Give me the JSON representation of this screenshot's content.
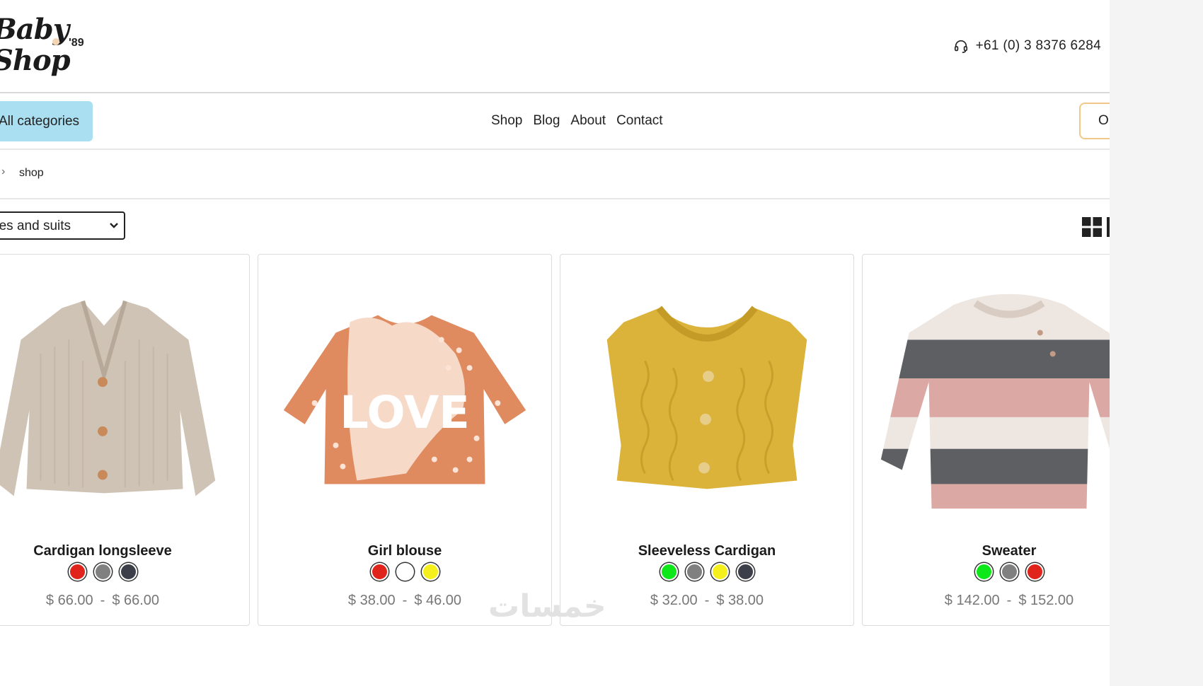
{
  "header": {
    "logo_line1": "Baby",
    "logo_line2": "Shop",
    "logo_year": "'89",
    "phone": "+61 (0) 3 8376 6284"
  },
  "nav": {
    "all_categories": "All categories",
    "menu": [
      "Shop",
      "Blog",
      "About",
      "Contact"
    ],
    "cart_label": "O"
  },
  "breadcrumb": {
    "separator": "›",
    "current": "shop"
  },
  "filter": {
    "selected_category": "Dresses and suits"
  },
  "products": [
    {
      "name": "Cardigan longsleeve",
      "colors": [
        "#e0241b",
        "#808080",
        "#3c3f49"
      ],
      "price_min": "$ 66.00",
      "price_max": "$ 66.00"
    },
    {
      "name": "Girl blouse",
      "colors": [
        "#e0241b",
        "#ffffff",
        "#f5f01b"
      ],
      "price_min": "$ 38.00",
      "price_max": "$ 46.00"
    },
    {
      "name": "Sleeveless Cardigan",
      "colors": [
        "#0ee81a",
        "#808080",
        "#f5f01b",
        "#3c3f49"
      ],
      "price_min": "$ 32.00",
      "price_max": "$ 38.00"
    },
    {
      "name": "Sweater",
      "colors": [
        "#0ee81a",
        "#808080",
        "#e0241b"
      ],
      "price_min": "$ 142.00",
      "price_max": "$ 152.00"
    }
  ],
  "price_separator": "-",
  "watermark": "خمسات"
}
